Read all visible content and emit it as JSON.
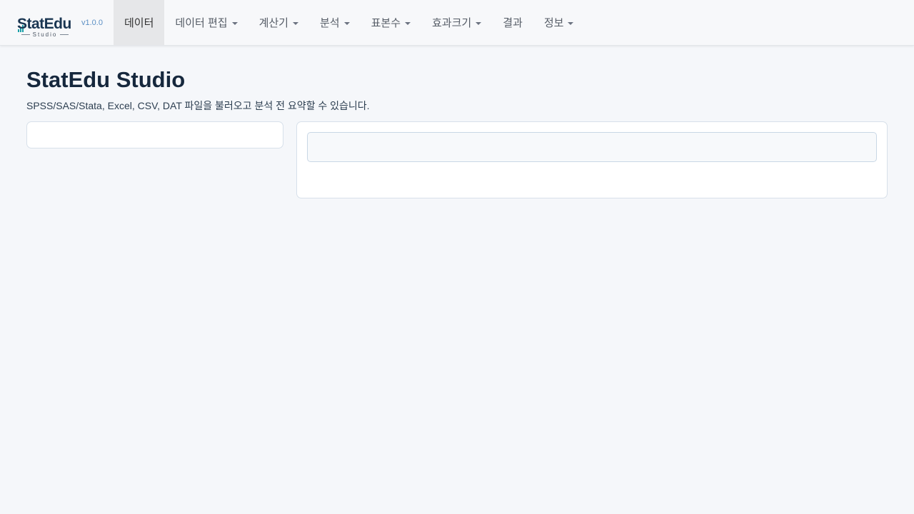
{
  "app": {
    "logo_text": "StatEdu",
    "logo_subtext": "Studio",
    "version": "v1.0.0"
  },
  "nav": [
    {
      "label": "데이터",
      "active": true,
      "dropdown": false
    },
    {
      "label": "데이터 편집",
      "active": false,
      "dropdown": true
    },
    {
      "label": "계산기",
      "active": false,
      "dropdown": true
    },
    {
      "label": "분석",
      "active": false,
      "dropdown": true
    },
    {
      "label": "표본수",
      "active": false,
      "dropdown": true
    },
    {
      "label": "효과크기",
      "active": false,
      "dropdown": true
    },
    {
      "label": "결과",
      "active": false,
      "dropdown": false
    },
    {
      "label": "정보",
      "active": false,
      "dropdown": true
    }
  ],
  "main": {
    "title": "StatEdu Studio",
    "subtitle": "SPSS/SAS/Stata, Excel, CSV, DAT 파일을 불러오고 분석 전 요약할 수 있습니다."
  },
  "colors": {
    "brand_dark": "#1a3652",
    "brand_accent": "#1aa0a8",
    "version": "#5b8fc4",
    "page_bg": "#f5f7fa"
  }
}
